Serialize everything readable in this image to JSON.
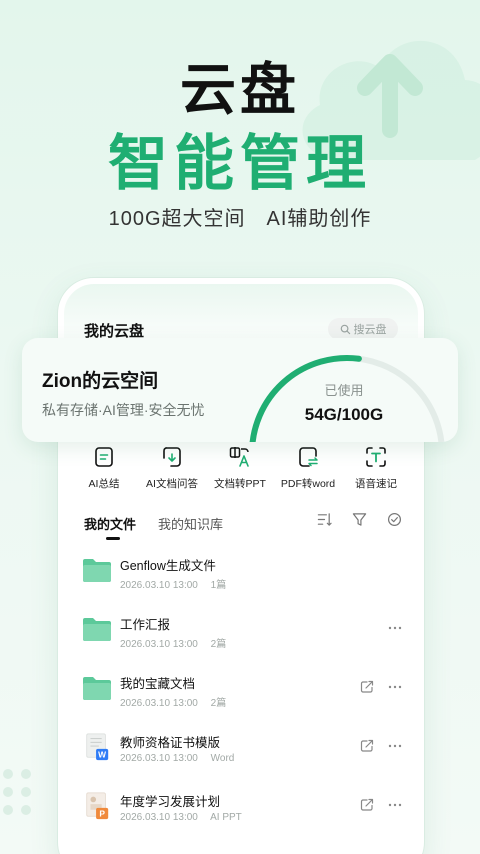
{
  "hero": {
    "title_line1": "云盘",
    "title_line2": "智能管理",
    "subtitle": "100G超大空间　AI辅助创作"
  },
  "app": {
    "title": "我的云盘",
    "search_placeholder": "搜云盘"
  },
  "storage": {
    "space_name": "Zion的云空间",
    "description": "私有存储·AI管理·安全无忧",
    "used_label": "已使用",
    "used_value": "54G/100G",
    "used_fraction": 0.54
  },
  "tools": [
    {
      "label": "AI总结",
      "icon": "ai-summary-icon"
    },
    {
      "label": "AI文档问答",
      "icon": "doc-qa-icon"
    },
    {
      "label": "文档转PPT",
      "icon": "doc-to-ppt-icon"
    },
    {
      "label": "PDF转word",
      "icon": "pdf-to-word-icon"
    },
    {
      "label": "语音速记",
      "icon": "voice-note-icon"
    }
  ],
  "tabs": {
    "my_files": "我的文件",
    "knowledge_base": "我的知识库"
  },
  "files": [
    {
      "name": "Genflow生成文件",
      "date": "2026.03.10 13:00",
      "info": "1篇",
      "type": "folder",
      "share": false,
      "more": false
    },
    {
      "name": "工作汇报",
      "date": "2026.03.10 13:00",
      "info": "2篇",
      "type": "folder",
      "share": false,
      "more": true
    },
    {
      "name": "我的宝藏文档",
      "date": "2026.03.10 13:00",
      "info": "2篇",
      "type": "folder",
      "share": true,
      "more": true
    },
    {
      "name": "教师资格证书模版",
      "date": "2026.03.10 13:00",
      "info": "Word",
      "type": "word",
      "share": true,
      "more": true
    },
    {
      "name": "年度学习发展计划",
      "date": "2026.03.10 13:00",
      "info": "AI PPT",
      "type": "ppt",
      "share": true,
      "more": true
    }
  ],
  "colors": {
    "accent": "#1fae72",
    "folder": "#5cc99a",
    "word_badge": "#2f7cf6",
    "ppt_badge": "#f08a3c"
  }
}
